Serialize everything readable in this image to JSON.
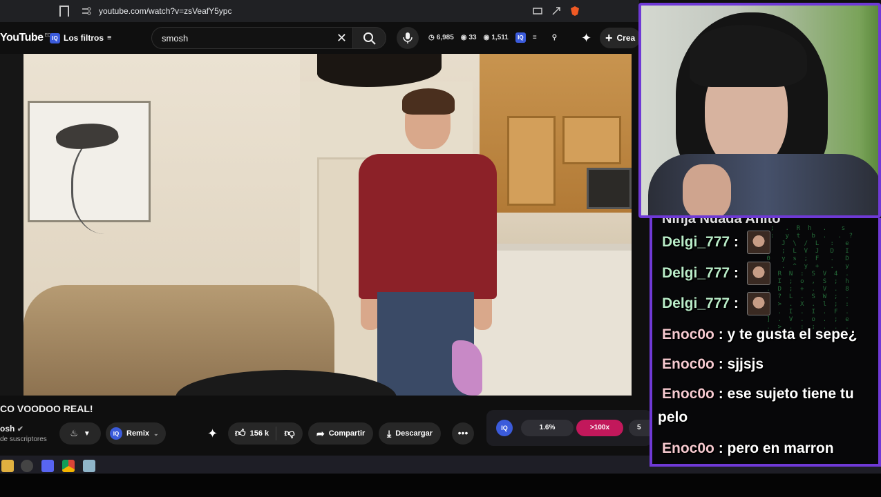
{
  "browser": {
    "url": "youtube.com/watch?v=zsVeafY5ypc"
  },
  "header": {
    "logo": "YouTube",
    "region": "EC",
    "filters_label": "Los filtros",
    "search_query": "smosh",
    "stats": [
      "6,985",
      "33",
      "1,511"
    ],
    "create_label": "Crea"
  },
  "video": {
    "title": "CO VOODOO REAL!",
    "channel": "osh",
    "subscribers": "de suscriptores",
    "remix_label": "Remix",
    "likes": "156 k",
    "share_label": "Compartir",
    "download_label": "Descargar",
    "more_label": "•••"
  },
  "extension": {
    "badge": "IQ",
    "percent": "1.6%",
    "multiplier": ">100x",
    "extra": "5"
  },
  "chat": {
    "cut_line": "Ninja Nuada Ahito",
    "messages": [
      {
        "user": "Delgi_777",
        "text": "",
        "emote": true
      },
      {
        "user": "Delgi_777",
        "text": "",
        "emote": true
      },
      {
        "user": "Delgi_777",
        "text": "",
        "emote": true
      },
      {
        "user": "Enoc0o",
        "text": "y te gusta el sepe¿"
      },
      {
        "user": "Enoc0o",
        "text": "sjjsjs"
      },
      {
        "user": "Enoc0o",
        "text": "ese sujeto tiene tu pelo"
      },
      {
        "user": "Enoc0o",
        "text": "pero en marron"
      }
    ]
  },
  "colors": {
    "border_accent": "#6f39d6",
    "user_green": "#b9ecc8",
    "user_pink": "#f6c9cf",
    "multiplier_bg": "#c2185b"
  }
}
